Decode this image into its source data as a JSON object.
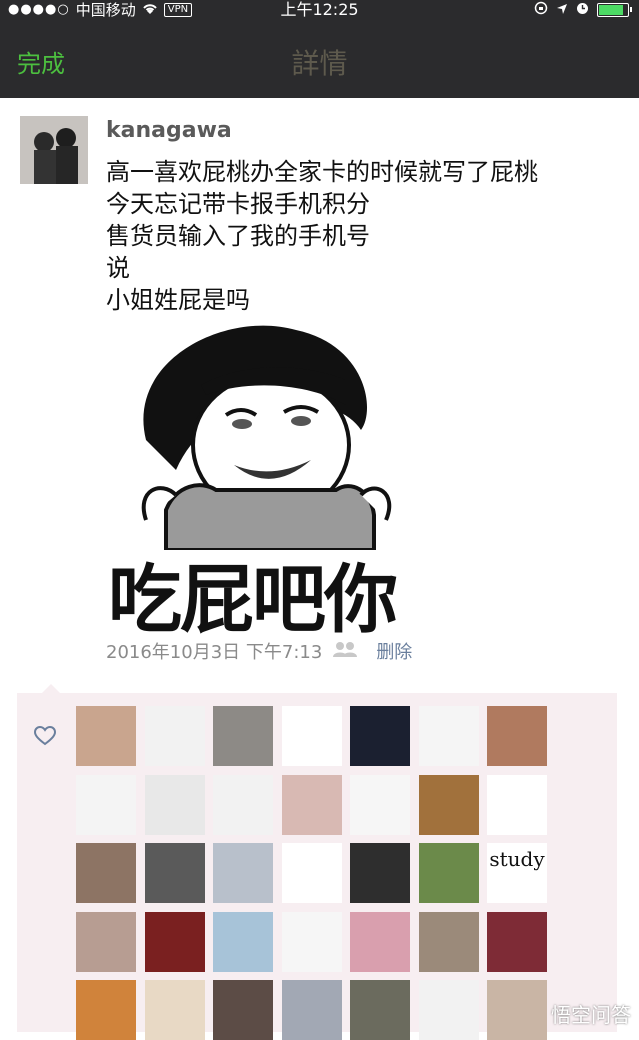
{
  "status_bar": {
    "signal": "●●●●○",
    "carrier": "中国移动",
    "vpn": "VPN",
    "time": "上午12:25"
  },
  "nav": {
    "done": "完成",
    "title": "詳情"
  },
  "post": {
    "username": "kanagawa",
    "lines": [
      "高一喜欢屁桃办全家卡的时候就写了屁桃",
      "今天忘记带卡报手机积分",
      "售货员输入了我的手机号",
      "说",
      "小姐姓屁是吗"
    ],
    "meme_caption": "吃屁吧你",
    "timestamp": "2016年10月3日 下午7:13",
    "delete": "删除"
  },
  "likes": {
    "study_text": "study",
    "colors": [
      "#c9a58e",
      "#f2f2f2",
      "#8d8a86",
      "#ffffff",
      "#1b2030",
      "#f5f5f5",
      "#b07a5f",
      "#f4f4f4",
      "#e8e8e8",
      "#f2f2f2",
      "#d8b9b3",
      "#f6f6f6",
      "#a1713c",
      "#ffffff",
      "#8d7464",
      "#5a5a5a",
      "#b8c0cb",
      "#ffffff",
      "#2e2e2e",
      "#6b8a4a",
      "#ffffff",
      "#b79d92",
      "#7a2020",
      "#a7c3d8",
      "#f6f6f6",
      "#d99fae",
      "#9b8a7a",
      "#7e2b36",
      "#d0833b",
      "#e8d9c5",
      "#5c4c46",
      "#a2a8b4",
      "#6b6b5e",
      "#f2f2f2",
      "#c9b5a5"
    ]
  },
  "watermark": "悟空问答"
}
